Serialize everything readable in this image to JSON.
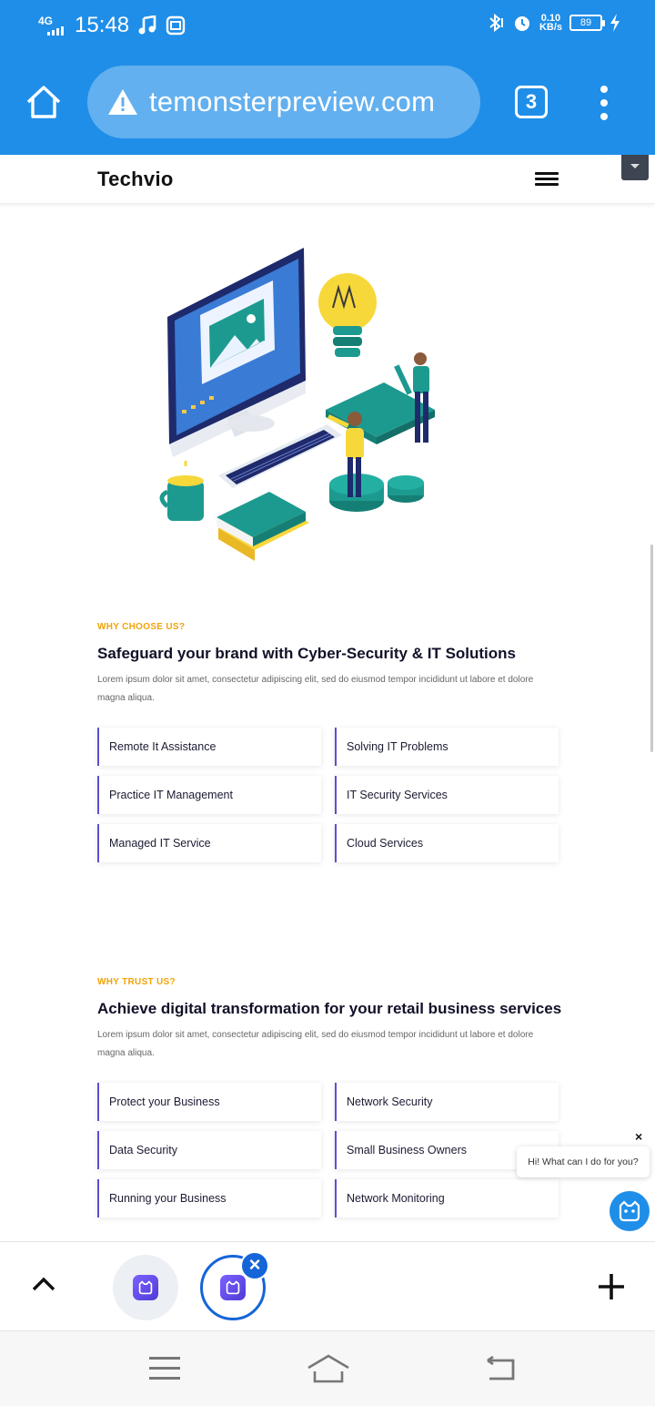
{
  "status_bar": {
    "network": "4G",
    "time": "15:48",
    "speed_value": "0.10",
    "speed_unit": "KB/s",
    "battery": "89"
  },
  "browser": {
    "url": "temonsterpreview.com",
    "tab_count": "3"
  },
  "site": {
    "logo": "Techvio"
  },
  "section1": {
    "eyebrow": "WHY CHOOSE US?",
    "title": "Safeguard your brand with Cyber-Security & IT Solutions",
    "desc": "Lorem ipsum dolor sit amet, consectetur adipiscing elit, sed do eiusmod tempor incididunt ut labore et dolore magna aliqua.",
    "features": [
      "Remote It Assistance",
      "Solving IT Problems",
      "Practice IT Management",
      "IT Security Services",
      "Managed IT Service",
      "Cloud Services"
    ]
  },
  "section2": {
    "eyebrow": "WHY TRUST US?",
    "title": "Achieve digital transformation for your retail business services",
    "desc": "Lorem ipsum dolor sit amet, consectetur adipiscing elit, sed do eiusmod tempor incididunt ut labore et dolore magna aliqua.",
    "features": [
      "Protect your Business",
      "Network Security",
      "Data Security",
      "Small Business Owners",
      "Running your Business",
      "Network Monitoring"
    ]
  },
  "chat": {
    "close": "×",
    "greeting": "Hi! What can I do for you?"
  },
  "tabbar": {
    "close": "×"
  },
  "colors": {
    "browser_blue": "#1f8ee8",
    "accent_orange": "#f0a30a",
    "accent_purple": "#5b4fd6",
    "teal": "#1d9a8f"
  }
}
